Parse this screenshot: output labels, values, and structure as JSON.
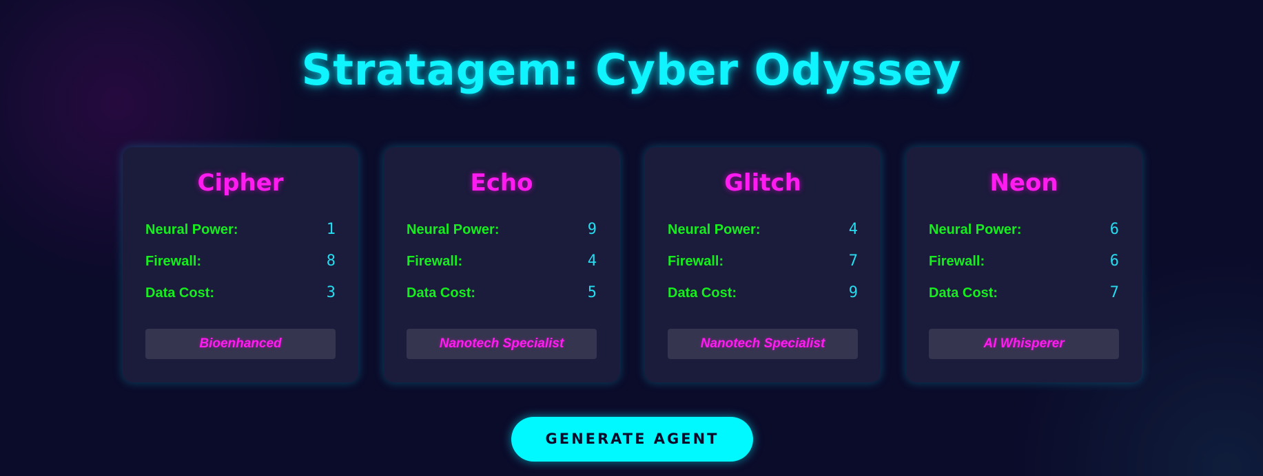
{
  "header": {
    "title": "Stratagem: Cyber Odyssey"
  },
  "agents": [
    {
      "name": "Cipher",
      "stats": [
        {
          "label": "Neural Power:",
          "value": "1"
        },
        {
          "label": "Firewall:",
          "value": "8"
        },
        {
          "label": "Data Cost:",
          "value": "3"
        }
      ],
      "ability": "Bioenhanced"
    },
    {
      "name": "Echo",
      "stats": [
        {
          "label": "Neural Power:",
          "value": "9"
        },
        {
          "label": "Firewall:",
          "value": "4"
        },
        {
          "label": "Data Cost:",
          "value": "5"
        }
      ],
      "ability": "Nanotech Specialist"
    },
    {
      "name": "Glitch",
      "stats": [
        {
          "label": "Neural Power:",
          "value": "4"
        },
        {
          "label": "Firewall:",
          "value": "7"
        },
        {
          "label": "Data Cost:",
          "value": "9"
        }
      ],
      "ability": "Nanotech Specialist"
    },
    {
      "name": "Neon",
      "stats": [
        {
          "label": "Neural Power:",
          "value": "6"
        },
        {
          "label": "Firewall:",
          "value": "6"
        },
        {
          "label": "Data Cost:",
          "value": "7"
        }
      ],
      "ability": "AI Whisperer"
    }
  ],
  "actions": {
    "generate_label": "GENERATE AGENT"
  },
  "colors": {
    "background": "#0b0b2a",
    "title_cyan": "#0ff4ff",
    "agent_name_magenta": "#ff1cf0",
    "stat_label_green": "#16ee1e",
    "stat_value_cyan": "#27dcef",
    "card_background": "#1b1b3b",
    "ability_background": "#35354f",
    "button_cyan": "#00f8ff"
  }
}
